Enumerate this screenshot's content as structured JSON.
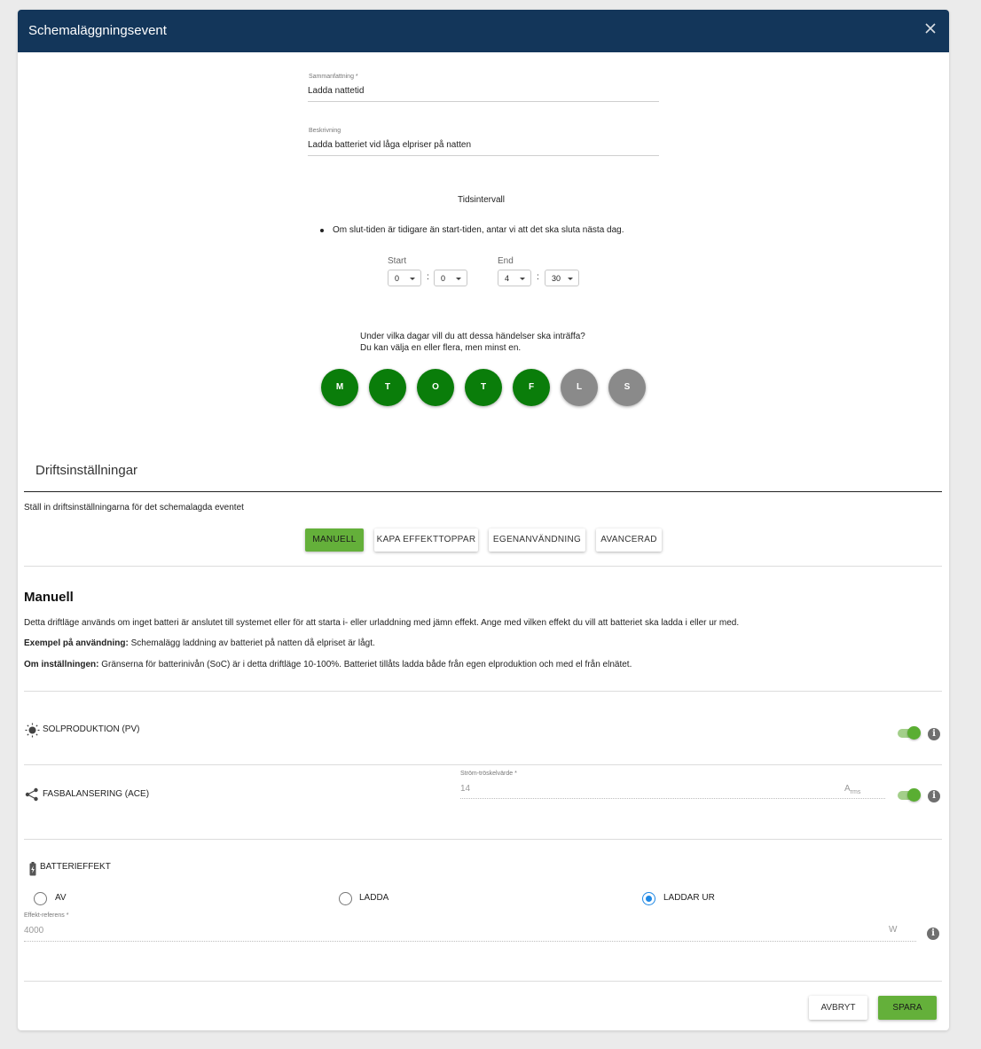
{
  "dialog": {
    "title": "Schemaläggningsevent"
  },
  "summary": {
    "label": "Sammanfattning *",
    "value": "Ladda nattetid"
  },
  "description": {
    "label": "Beskrivning",
    "value": "Ladda batteriet vid låga elpriser på natten"
  },
  "time_interval": {
    "heading": "Tidsintervall",
    "note": "Om slut-tiden är tidigare än start-tiden, antar vi att det ska sluta nästa dag.",
    "start_label": "Start",
    "end_label": "End",
    "start_hour": "0",
    "start_minute": "0",
    "end_hour": "4",
    "end_minute": "30",
    "separator": ":"
  },
  "days": {
    "question": "Under vilka dagar vill du att dessa händelser ska inträffa?",
    "hint": "Du kan välja en eller flera, men minst en.",
    "items": [
      {
        "label": "M",
        "active": true
      },
      {
        "label": "T",
        "active": true
      },
      {
        "label": "O",
        "active": true
      },
      {
        "label": "T",
        "active": true
      },
      {
        "label": "F",
        "active": true
      },
      {
        "label": "L",
        "active": false
      },
      {
        "label": "S",
        "active": false
      }
    ],
    "active_color": "#0a7d0a",
    "inactive_color": "#8a8a8a"
  },
  "operation": {
    "heading": "Driftsinställningar",
    "subtitle": "Ställ in driftsinställningarna för det schemalagda eventet",
    "modes": [
      "MANUELL",
      "KAPA EFFEKTTOPPAR",
      "EGENANVÄNDNING",
      "AVANCERAD"
    ],
    "active_mode": "MANUELL"
  },
  "manual": {
    "title": "Manuell",
    "text": "Detta driftläge används om inget batteri är anslutet till systemet eller för att starta i- eller urladdning med jämn effekt. Ange med vilken effekt du vill att batteriet ska ladda i eller ur med.",
    "example_label": "Exempel på användning:",
    "example_text": " Schemalägg laddning av batteriet på natten då elpriset är lågt.",
    "setting_label": "Om inställningen:",
    "setting_text": " Gränserna för batterinivån (SoC) är i detta driftläge 10-100%. Batteriet tillåts ladda både från egen elproduktion och med el från elnätet."
  },
  "settings": {
    "pv": {
      "label": "SOLPRODUKTION (PV)",
      "enabled": true
    },
    "ace": {
      "label": "FASBALANSERING (ACE)",
      "enabled": true,
      "threshold_label": "Ström-tröskelvärde *",
      "threshold_value": "14",
      "unit_main": "A",
      "unit_sub": "rms"
    },
    "battery": {
      "label": "BATTERIEFFEKT",
      "options": [
        "AV",
        "LADDA",
        "LADDAR UR"
      ],
      "selected": "LADDAR UR",
      "power_label": "Effekt-referens *",
      "power_value": "4000",
      "power_unit": "W"
    }
  },
  "footer": {
    "cancel": "AVBRYT",
    "save": "SPARA"
  },
  "colors": {
    "header": "#13365a",
    "accent_green": "#64b03a",
    "radio_blue": "#1e88e5"
  }
}
